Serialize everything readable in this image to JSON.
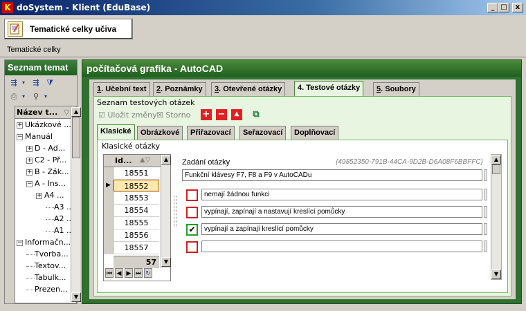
{
  "window": {
    "title": "doSystem - Klient (EduBase)",
    "logo": "K",
    "buttons": {
      "minimize": "_",
      "maximize": "□",
      "close": "x"
    }
  },
  "header": {
    "app_button_label": "Tematické celky učiva",
    "breadcrumb": "Tematické celky"
  },
  "left_panel": {
    "title": "Seznam temat",
    "column_header": "Název t...",
    "tree": [
      {
        "label": "Ukázkové ...",
        "expander": "+"
      },
      {
        "label": "Manuál",
        "expander": "−"
      },
      {
        "label": "D - Ad...",
        "expander": "+"
      },
      {
        "label": "C2 - Př...",
        "expander": "+"
      },
      {
        "label": "B - Zák...",
        "expander": "+"
      },
      {
        "label": "A - Ins...",
        "expander": "−"
      },
      {
        "label": "A4 ...",
        "expander": "+"
      },
      {
        "label": "A3 ...",
        "expander": ""
      },
      {
        "label": "A2 ...",
        "expander": ""
      },
      {
        "label": "A1 ...",
        "expander": ""
      },
      {
        "label": "Informačn...",
        "expander": "−"
      },
      {
        "label": "Tvorba...",
        "expander": ""
      },
      {
        "label": "Textov...",
        "expander": ""
      },
      {
        "label": "Tabulk...",
        "expander": ""
      },
      {
        "label": "Prezen...",
        "expander": ""
      }
    ]
  },
  "main": {
    "title": "počítačová grafika - AutoCAD",
    "tabs": [
      {
        "key": "1",
        "label": ". Učební text"
      },
      {
        "key": "2",
        "label": ". Poznámky"
      },
      {
        "key": "3",
        "label": ". Otevřené otázky"
      },
      {
        "key": "4",
        "label": ". Testové otázky"
      },
      {
        "key": "5",
        "label": ". Soubory"
      }
    ],
    "test_list_caption": "Seznam testových otázek",
    "toolbar": {
      "save_label": "Uložit změny",
      "cancel_label": "Storno",
      "add": "+",
      "remove": "−",
      "up": "▲"
    },
    "subtabs": [
      "Klasické",
      "Obrázkové",
      "Přiřazovací",
      "Seřazovací",
      "Doplňovací"
    ],
    "classic_caption": "Klasické otázky",
    "grid": {
      "column_header": "Id...",
      "rows": [
        "18551",
        "18552",
        "18553",
        "18554",
        "18555",
        "18556",
        "18557"
      ],
      "selected_index": 1,
      "count": "57"
    },
    "form": {
      "question_label": "Zadání otázky",
      "guid": "{49852350-791B-44CA-9D2B-D6A08F6BBFFC}",
      "question_value": "Funkční klávesy F7, F8 a F9 v AutoCADu",
      "answers": [
        {
          "text": "nemají žádnou funkci",
          "correct": false
        },
        {
          "text": "vypínají, zapínají a nastavují kreslící pomůcky",
          "correct": false
        },
        {
          "text": "vypínají a zapínají kreslící pomůcky",
          "correct": true
        },
        {
          "text": "",
          "correct": false
        }
      ],
      "check_mark": "✔"
    }
  }
}
